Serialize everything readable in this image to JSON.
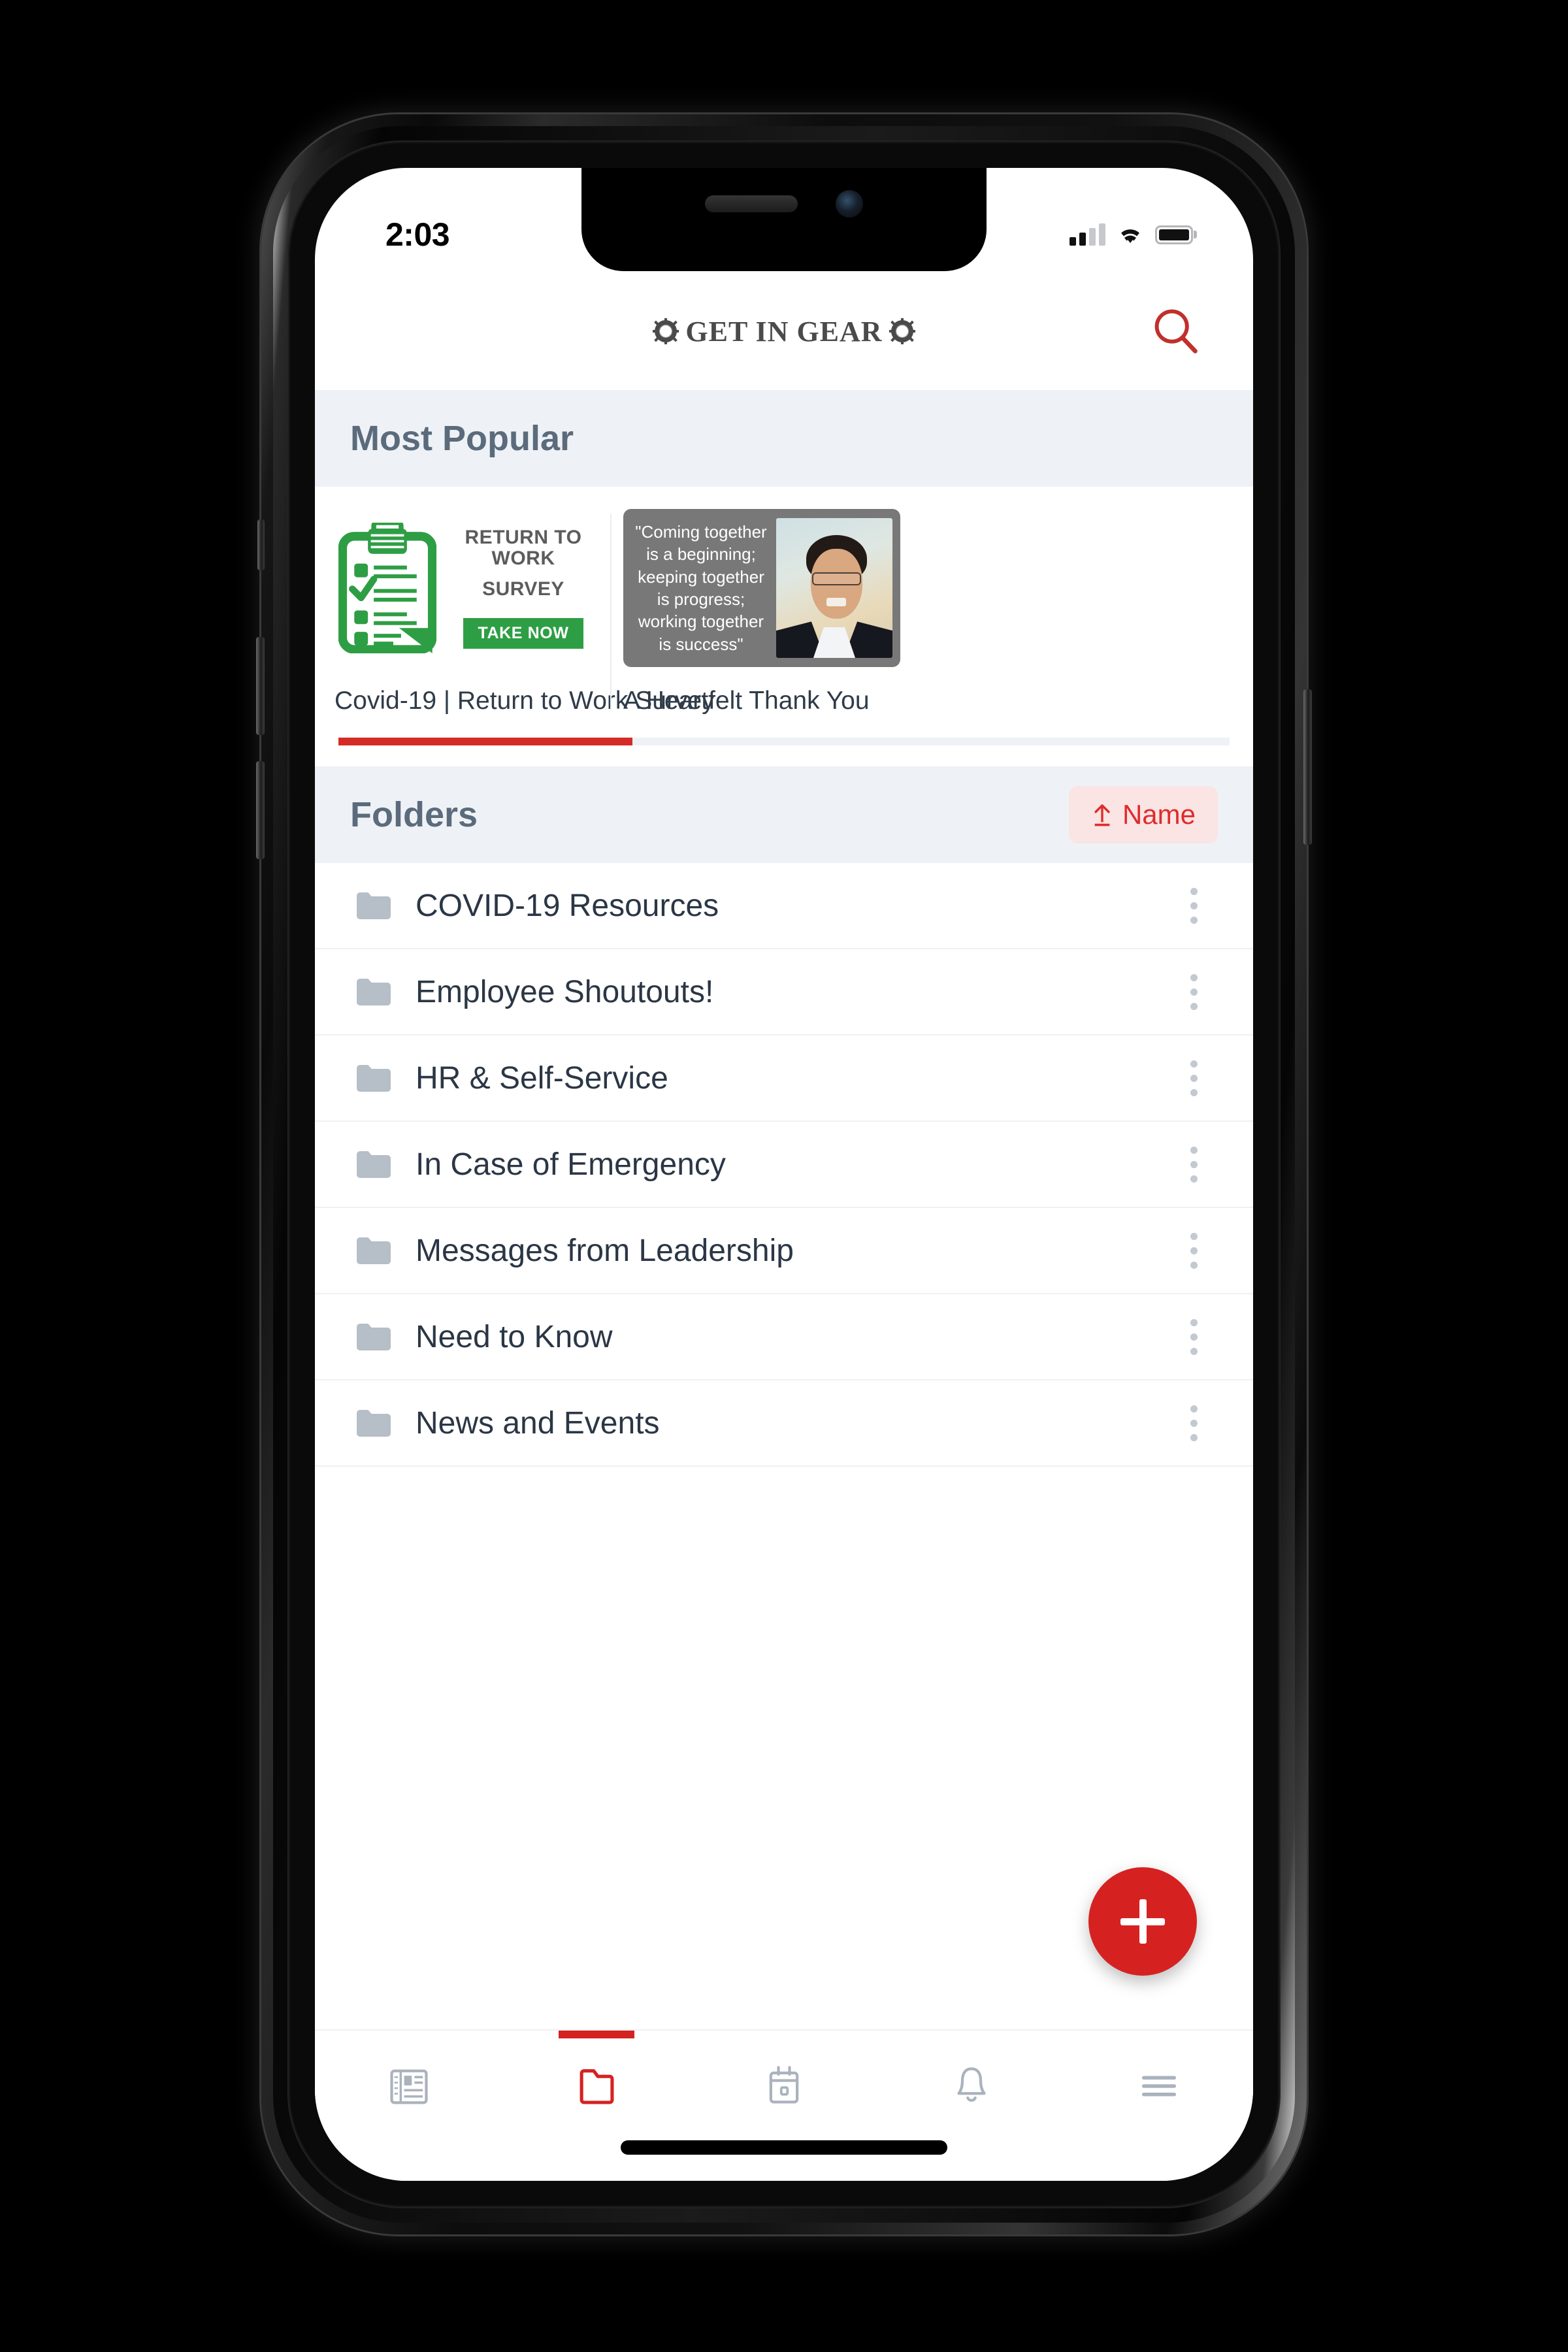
{
  "status_bar": {
    "time": "2:03",
    "signal_bars_filled": 2,
    "signal_bars_total": 4,
    "wifi_icon": "wifi-icon",
    "battery_icon": "battery-full-icon"
  },
  "header": {
    "brand_title": "GET IN GEAR",
    "left_gear_icon": "gear-icon",
    "right_gear_icon": "gear-icon",
    "search_icon": "search-icon",
    "accent_color": "#d52221"
  },
  "most_popular": {
    "title": "Most Popular",
    "cards": [
      {
        "caption": "Covid-19 | Return to Work Survey",
        "thumb_type": "survey-graphic",
        "thumb_line1": "RETURN TO WORK",
        "thumb_line2": "SURVEY",
        "thumb_badge": "TAKE NOW",
        "thumb_accent": "#2e9e44",
        "clipboard_icon": "clipboard-checklist-icon"
      },
      {
        "caption": "A Heartfelt Thank You",
        "thumb_type": "quote-graphic",
        "quote_line1": "\"Coming together",
        "quote_line2": "is a beginning;",
        "quote_line3": "keeping together",
        "quote_line4": "is progress;",
        "quote_line5": "working together",
        "quote_line6": "is success\"",
        "thumb_bg": "#787878",
        "portrait_icon": "portrait-photo"
      }
    ],
    "scroll_progress_percent": 33,
    "scroll_progress_color": "#d52b26"
  },
  "folders_section": {
    "title": "Folders",
    "sort_button": {
      "label": "Name",
      "direction_icon": "arrow-up-icon",
      "text_color": "#e02b2b",
      "background_color": "#fae4e4"
    },
    "items": [
      {
        "name": "COVID-19 Resources",
        "icon": "folder-icon",
        "menu_icon": "kebab-menu-icon"
      },
      {
        "name": "Employee Shoutouts!",
        "icon": "folder-icon",
        "menu_icon": "kebab-menu-icon"
      },
      {
        "name": "HR & Self-Service",
        "icon": "folder-icon",
        "menu_icon": "kebab-menu-icon"
      },
      {
        "name": "In Case of Emergency",
        "icon": "folder-icon",
        "menu_icon": "kebab-menu-icon"
      },
      {
        "name": "Messages from Leadership",
        "icon": "folder-icon",
        "menu_icon": "kebab-menu-icon"
      },
      {
        "name": "Need to Know",
        "icon": "folder-icon",
        "menu_icon": "kebab-menu-icon"
      },
      {
        "name": "News and Events",
        "icon": "folder-icon",
        "menu_icon": "kebab-menu-icon"
      }
    ]
  },
  "fab": {
    "icon": "plus-icon",
    "color": "#d52221"
  },
  "tab_bar": {
    "active_index": 1,
    "active_color": "#d52221",
    "inactive_color": "#aab3bd",
    "tabs": [
      {
        "icon": "news-icon",
        "active": false
      },
      {
        "icon": "folder-icon",
        "active": true
      },
      {
        "icon": "calendar-icon",
        "active": false
      },
      {
        "icon": "bell-icon",
        "active": false
      },
      {
        "icon": "hamburger-menu-icon",
        "active": false
      }
    ]
  }
}
